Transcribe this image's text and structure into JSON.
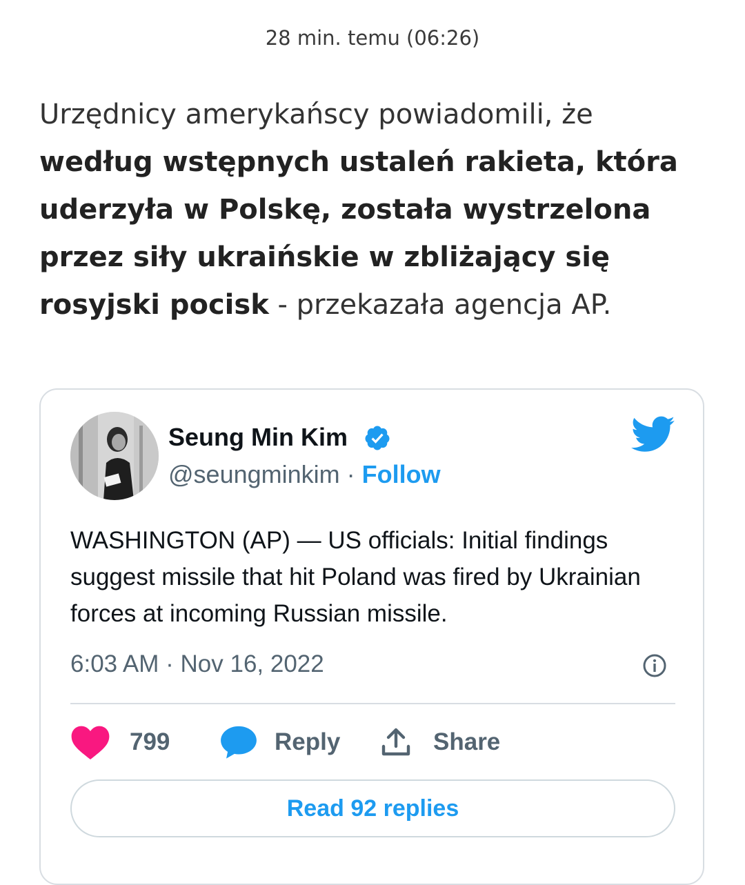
{
  "post": {
    "timestamp": "28 min. temu (06:26)",
    "text_intro": "Urzędnicy amerykańscy powiadomili, że ",
    "text_bold": "według wstępnych ustaleń rakieta, która uderzyła w Polskę, została wystrzelona przez siły ukraińskie w zbliżający się rosyjski pocisk",
    "text_outro": " - przekazała agencja AP."
  },
  "tweet": {
    "author_name": "Seung Min Kim",
    "handle": "@seungminkim",
    "separator": " · ",
    "follow_label": "Follow",
    "text": "WASHINGTON (AP) — US officials: Initial findings suggest missile that hit Poland was fired by Ukrainian forces at incoming Russian missile.",
    "time": "6:03 AM · Nov 16, 2022",
    "likes": "799",
    "reply_label": "Reply",
    "share_label": "Share",
    "read_replies_label": "Read 92 replies"
  },
  "icons": {
    "verified": "verified-badge-icon",
    "bird": "twitter-bird-icon",
    "info": "info-icon",
    "heart": "heart-icon",
    "reply": "speech-bubble-icon",
    "share": "share-upload-icon"
  },
  "colors": {
    "twitter_blue": "#1d9bf0",
    "heart_pink": "#f91880",
    "secondary_text": "#536471",
    "border": "#d8dde2"
  }
}
